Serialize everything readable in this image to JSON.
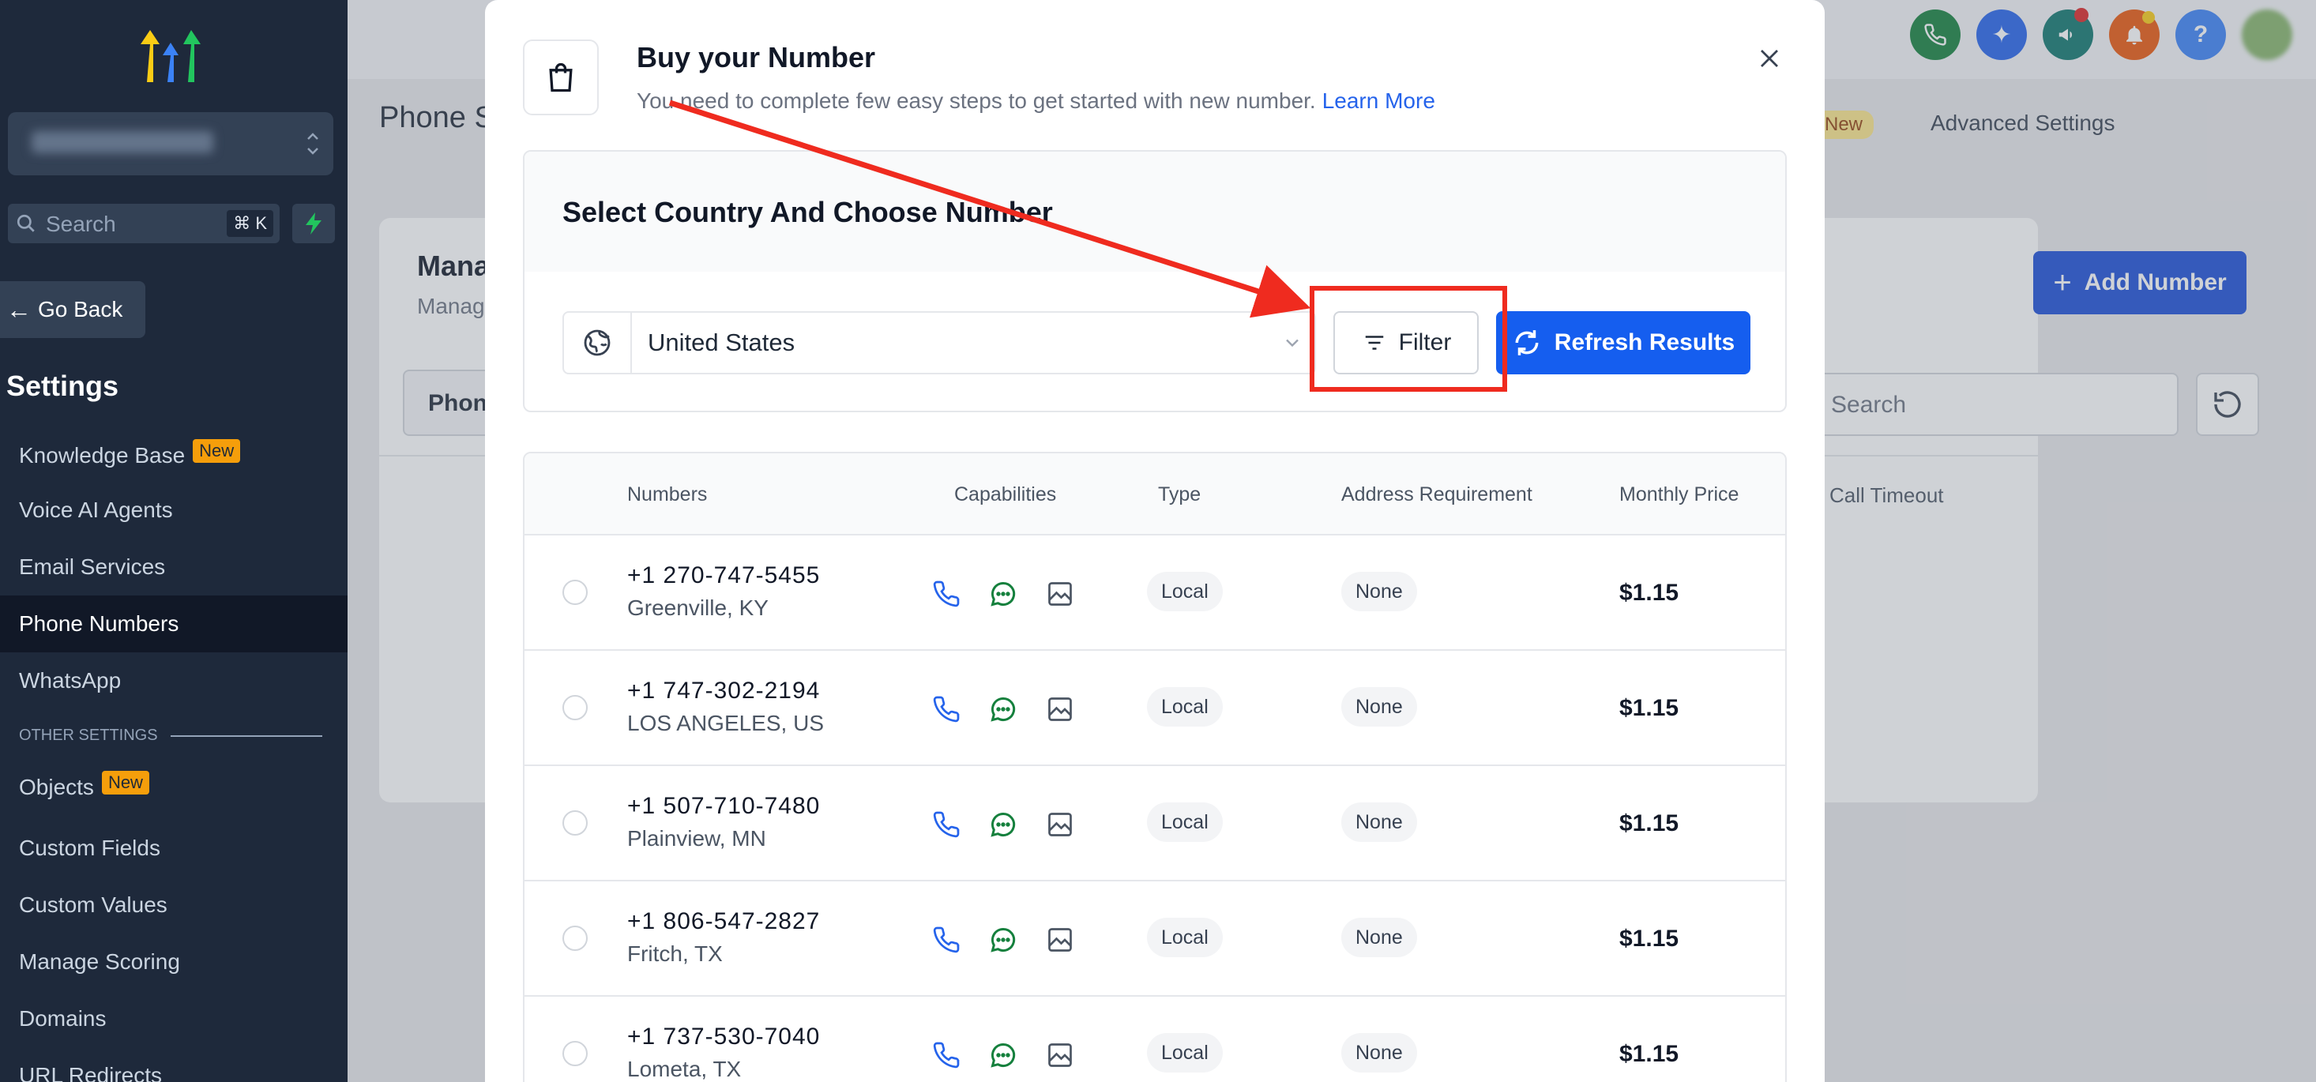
{
  "sidebar": {
    "search_placeholder": "Search",
    "search_shortcut": "⌘ K",
    "go_back": "Go Back",
    "section_title": "Settings",
    "items": [
      {
        "label": "Knowledge Base",
        "badge": "New"
      },
      {
        "label": "Voice AI Agents"
      },
      {
        "label": "Email Services"
      },
      {
        "label": "Phone Numbers",
        "active": true
      },
      {
        "label": "WhatsApp"
      }
    ],
    "other_settings_label": "OTHER SETTINGS",
    "other_items": [
      {
        "label": "Objects",
        "badge": "New"
      },
      {
        "label": "Custom Fields"
      },
      {
        "label": "Custom Values"
      },
      {
        "label": "Manage Scoring"
      },
      {
        "label": "Domains"
      },
      {
        "label": "URL Redirects"
      }
    ]
  },
  "background": {
    "page_title_partial": "Phone S",
    "tab_new_badge": "New",
    "tab_advanced": "Advanced Settings",
    "card_title_partial": "Mana",
    "card_sub_partial": "Manag",
    "add_number": "Add Number",
    "filter_tab_partial": "Phon",
    "search_placeholder": "Search",
    "col_call_timeout": "Call Timeout"
  },
  "modal": {
    "title": "Buy your Number",
    "subtitle": "You need to complete few easy steps to get started with new number.",
    "learn_more": "Learn More",
    "section_title": "Select Country And Choose Number",
    "country": "United States",
    "filter_label": "Filter",
    "refresh_label": "Refresh Results",
    "columns": [
      "Numbers",
      "Capabilities",
      "Type",
      "Address Requirement",
      "Monthly Price"
    ],
    "rows": [
      {
        "number": "+1 270-747-5455",
        "location": "Greenville, KY",
        "type": "Local",
        "address": "None",
        "price": "$1.15"
      },
      {
        "number": "+1 747-302-2194",
        "location": "LOS ANGELES, US",
        "type": "Local",
        "address": "None",
        "price": "$1.15"
      },
      {
        "number": "+1 507-710-7480",
        "location": "Plainview, MN",
        "type": "Local",
        "address": "None",
        "price": "$1.15"
      },
      {
        "number": "+1 806-547-2827",
        "location": "Fritch, TX",
        "type": "Local",
        "address": "None",
        "price": "$1.15"
      },
      {
        "number": "+1 737-530-7040",
        "location": "Lometa, TX",
        "type": "Local",
        "address": "None",
        "price": "$1.15"
      }
    ]
  },
  "colors": {
    "accent": "#155eef",
    "annotation": "#ef2b1f",
    "sidebar": "#1e293b"
  }
}
